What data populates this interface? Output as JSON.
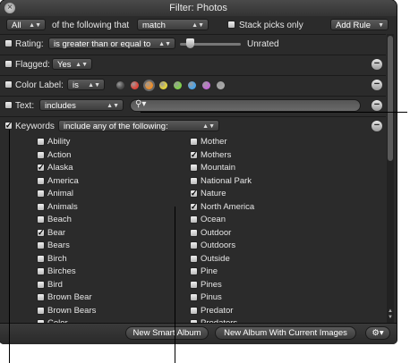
{
  "window": {
    "title": "Filter: Photos"
  },
  "match_row": {
    "scope_value": "All",
    "of_text": "of the following that",
    "match_value": "match",
    "stack_picks_label": "Stack picks only",
    "add_rule_label": "Add Rule"
  },
  "rating": {
    "label": "Rating:",
    "operator": "is greater than or equal to",
    "value_text": "Unrated"
  },
  "flagged": {
    "label": "Flagged:",
    "value": "Yes"
  },
  "color_label": {
    "label": "Color Label:",
    "operator": "is",
    "colors": [
      "#4a4a4a",
      "#e0453a",
      "#ef8f2a",
      "#e4d33a",
      "#7fd04a",
      "#4aa3e8",
      "#c46ad6",
      "#a8a8a8"
    ]
  },
  "text_rule": {
    "label": "Text:",
    "operator": "includes"
  },
  "keywords": {
    "label": "Keywords",
    "operator": "include any of the following:",
    "left": [
      {
        "name": "Ability",
        "checked": false
      },
      {
        "name": "Action",
        "checked": false
      },
      {
        "name": "Alaska",
        "checked": true
      },
      {
        "name": "America",
        "checked": false
      },
      {
        "name": "Animal",
        "checked": false
      },
      {
        "name": "Animals",
        "checked": false
      },
      {
        "name": "Beach",
        "checked": false
      },
      {
        "name": "Bear",
        "checked": true
      },
      {
        "name": "Bears",
        "checked": false
      },
      {
        "name": "Birch",
        "checked": false
      },
      {
        "name": "Birches",
        "checked": false
      },
      {
        "name": "Bird",
        "checked": false
      },
      {
        "name": "Brown Bear",
        "checked": false
      },
      {
        "name": "Brown Bears",
        "checked": false
      },
      {
        "name": "Color",
        "checked": false
      }
    ],
    "right": [
      {
        "name": "Mother",
        "checked": false
      },
      {
        "name": "Mothers",
        "checked": true
      },
      {
        "name": "Mountain",
        "checked": false
      },
      {
        "name": "National Park",
        "checked": false
      },
      {
        "name": "Nature",
        "checked": true
      },
      {
        "name": "North America",
        "checked": true
      },
      {
        "name": "Ocean",
        "checked": false
      },
      {
        "name": "Outdoor",
        "checked": false
      },
      {
        "name": "Outdoors",
        "checked": false
      },
      {
        "name": "Outside",
        "checked": false
      },
      {
        "name": "Pine",
        "checked": false
      },
      {
        "name": "Pines",
        "checked": false
      },
      {
        "name": "Pinus",
        "checked": false
      },
      {
        "name": "Predator",
        "checked": false
      },
      {
        "name": "Predators",
        "checked": false
      }
    ]
  },
  "bottom": {
    "new_smart_album": "New Smart Album",
    "new_album_current": "New Album With Current Images",
    "gear_icon": "gear-icon"
  }
}
